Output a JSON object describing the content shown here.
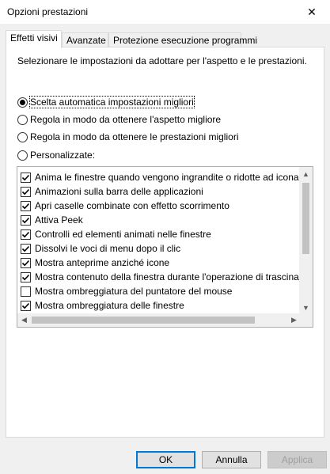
{
  "window": {
    "title": "Opzioni prestazioni",
    "close_glyph": "✕"
  },
  "tabs": [
    {
      "label": "Effetti visivi",
      "active": true
    },
    {
      "label": "Avanzate",
      "active": false
    },
    {
      "label": "Protezione esecuzione programmi",
      "active": false
    }
  ],
  "panel": {
    "description": "Selezionare le impostazioni da adottare per l'aspetto e le prestazioni.",
    "radios": [
      {
        "label": "Scelta automatica impostazioni migliori",
        "checked": true
      },
      {
        "label": "Regola in modo da ottenere l'aspetto migliore",
        "checked": false
      },
      {
        "label": "Regola in modo da ottenere le prestazioni migliori",
        "checked": false
      },
      {
        "label": "Personalizzate:",
        "checked": false
      }
    ],
    "effects": [
      {
        "label": "Anima le finestre quando vengono ingrandite o ridotte ad icona",
        "checked": true
      },
      {
        "label": "Animazioni sulla barra delle applicazioni",
        "checked": true
      },
      {
        "label": "Apri caselle combinate con effetto scorrimento",
        "checked": true
      },
      {
        "label": "Attiva Peek",
        "checked": true
      },
      {
        "label": "Controlli ed elementi animati nelle finestre",
        "checked": true
      },
      {
        "label": "Dissolvi le voci di menu dopo il clic",
        "checked": true
      },
      {
        "label": "Mostra anteprime anziché icone",
        "checked": true
      },
      {
        "label": "Mostra contenuto della finestra durante l'operazione di trascinamento",
        "checked": true
      },
      {
        "label": "Mostra ombreggiatura del puntatore del mouse",
        "checked": false
      },
      {
        "label": "Mostra ombreggiatura delle finestre",
        "checked": true
      }
    ]
  },
  "buttons": {
    "ok": "OK",
    "cancel": "Annulla",
    "apply": "Applica"
  },
  "colors": {
    "accent": "#0078d7",
    "disabled_text": "#a0a0a0"
  }
}
